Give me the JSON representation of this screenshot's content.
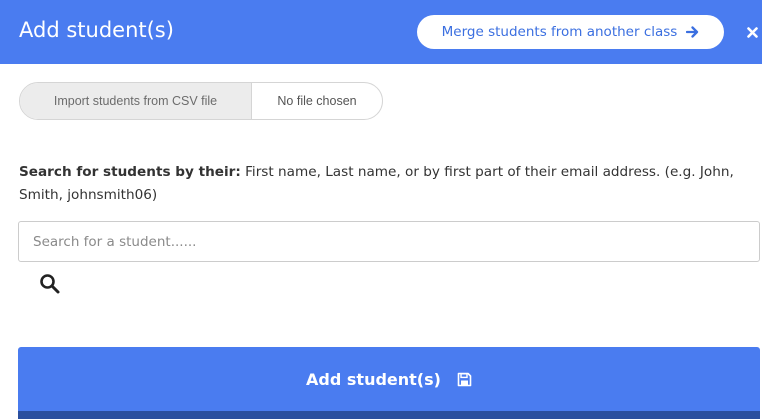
{
  "header": {
    "title": "Add student(s)",
    "merge_button_label": "Merge students from another class",
    "merge_icon": "arrow-right-icon",
    "close_icon": "close-icon"
  },
  "import": {
    "button_label": "Import students from CSV file",
    "file_status": "No file chosen"
  },
  "search": {
    "instructions_bold": "Search for students by their:",
    "instructions_text": " First name, Last name, or by first part of their email address. (e.g. John, Smith, johnsmith06)",
    "value": "",
    "placeholder": "Search for a student......",
    "icon": "search-icon"
  },
  "submit": {
    "label": "Add student(s)",
    "icon": "save-icon"
  },
  "colors": {
    "accent": "#4a7cf0",
    "accent_dark": "#2b4f9e",
    "link": "#3b6fe0"
  }
}
